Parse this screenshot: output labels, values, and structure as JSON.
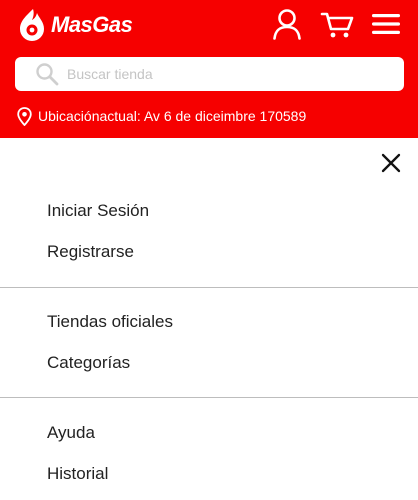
{
  "header": {
    "logo_text": "MasGas",
    "icons": [
      "user-icon",
      "cart-icon",
      "hamburger-menu-icon"
    ],
    "search": {
      "placeholder": "Buscar tienda"
    },
    "location": {
      "prefix": "Ubicaciónactual:",
      "address": "Av 6 de diceimbre 170589",
      "full_text": "Ubicaciónactual: Av 6 de diceimbre 170589"
    }
  },
  "menu": {
    "close_icon": "close-icon",
    "sections": [
      {
        "items": [
          {
            "label": "Iniciar Sesión"
          },
          {
            "label": "Registrarse"
          }
        ]
      },
      {
        "items": [
          {
            "label": "Tiendas oficiales"
          },
          {
            "label": "Categorías"
          }
        ]
      },
      {
        "items": [
          {
            "label": "Ayuda"
          },
          {
            "label": "Historial"
          }
        ]
      }
    ]
  },
  "colors": {
    "brand_red": "#f60000",
    "white": "#ffffff",
    "text": "#222222",
    "divider": "#bdbdbd",
    "placeholder": "#c4c4c4"
  }
}
